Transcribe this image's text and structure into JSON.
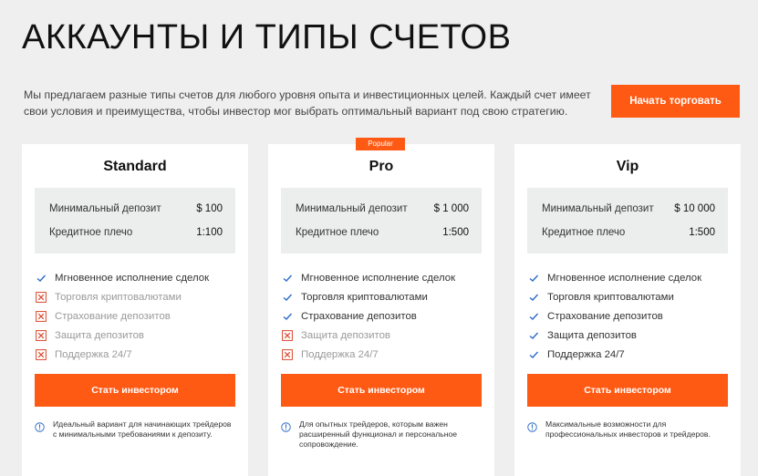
{
  "page": {
    "title": "АККАУНТЫ И ТИПЫ СЧЕТОВ",
    "intro": "Мы предлагаем разные типы счетов для любого уровня опыта и инвестиционных целей. Каждый счет имеет свои условия и преимущества, чтобы инвестор мог выбрать оптимальный вариант под свою стратегию.",
    "start_button": "Начать торговать"
  },
  "colors": {
    "accent": "#ff5a14",
    "check": "#2e6cc7",
    "cross": "#d9472b"
  },
  "labels": {
    "min_deposit": "Минимальный депозит",
    "leverage": "Кредитное плечо",
    "invest_button": "Стать инвестором"
  },
  "plans": [
    {
      "name": "Standard",
      "badge": "",
      "min_deposit": "$ 100",
      "leverage": "1:100",
      "features": [
        {
          "label": "Мгновенное исполнение сделок",
          "included": true
        },
        {
          "label": "Торговля криптовалютами",
          "included": false
        },
        {
          "label": "Страхование депозитов",
          "included": false
        },
        {
          "label": "Защита депозитов",
          "included": false
        },
        {
          "label": "Поддержка 24/7",
          "included": false
        }
      ],
      "note": "Идеальный вариант для начинающих трейдеров с минимальными требованиями к депозиту."
    },
    {
      "name": "Pro",
      "badge": "Popular",
      "min_deposit": "$ 1 000",
      "leverage": "1:500",
      "features": [
        {
          "label": "Мгновенное исполнение сделок",
          "included": true
        },
        {
          "label": "Торговля криптовалютами",
          "included": true
        },
        {
          "label": "Страхование депозитов",
          "included": true
        },
        {
          "label": "Защита депозитов",
          "included": false
        },
        {
          "label": "Поддержка 24/7",
          "included": false
        }
      ],
      "note": "Для опытных трейдеров, которым важен расширенный функционал и персональное сопровождение."
    },
    {
      "name": "Vip",
      "badge": "",
      "min_deposit": "$ 10 000",
      "leverage": "1:500",
      "features": [
        {
          "label": "Мгновенное исполнение сделок",
          "included": true
        },
        {
          "label": "Торговля криптовалютами",
          "included": true
        },
        {
          "label": "Страхование депозитов",
          "included": true
        },
        {
          "label": "Защита депозитов",
          "included": true
        },
        {
          "label": "Поддержка 24/7",
          "included": true
        }
      ],
      "note": "Максимальные возможности для профессиональных инвесторов и трейдеров."
    }
  ]
}
